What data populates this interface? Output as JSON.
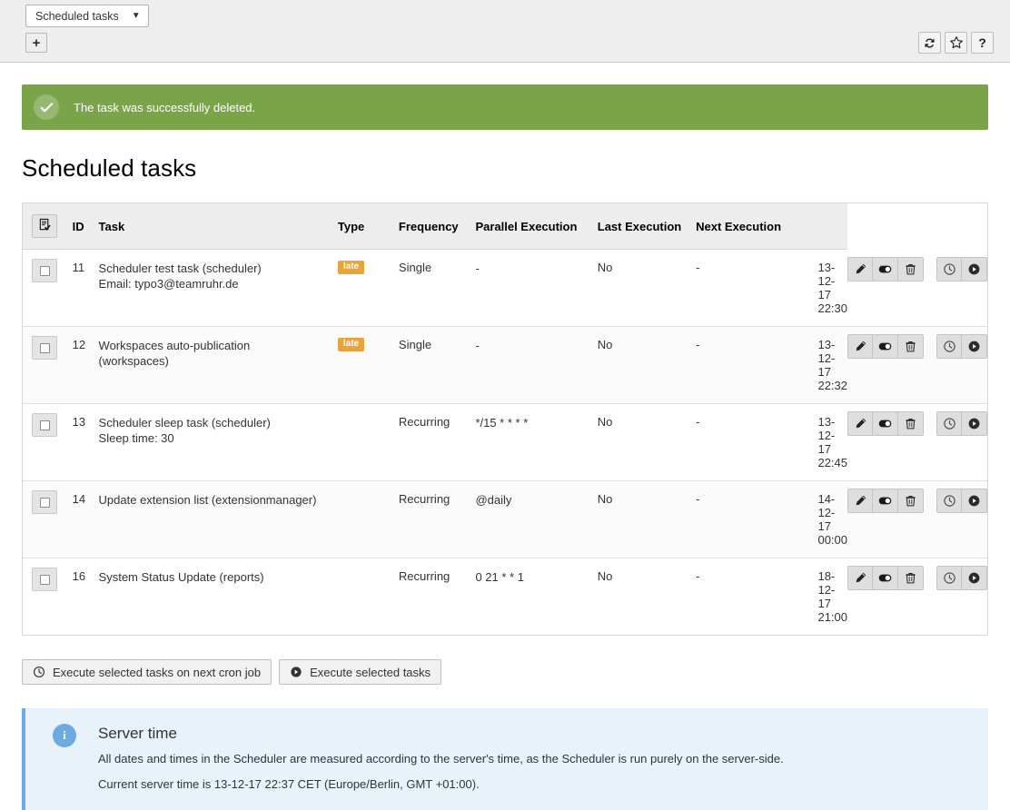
{
  "toolbar": {
    "module_select_value": "Scheduled tasks",
    "new_button_label": "+",
    "refresh_icon": "refresh-icon",
    "bookmark_icon": "star-icon",
    "help_label": "?"
  },
  "alert": {
    "icon": "checkmark-icon",
    "message": "The task was successfully deleted."
  },
  "page_title": "Scheduled tasks",
  "table": {
    "headers": {
      "check": "",
      "id": "ID",
      "task": "Task",
      "type": "Type",
      "frequency": "Frequency",
      "parallel": "Parallel Execution",
      "last": "Last Execution",
      "next": "Next Execution"
    },
    "rows": [
      {
        "id": "11",
        "task_title": "Scheduler test task (scheduler)",
        "task_sub": "Email: typo3@teamruhr.de",
        "badge": "late",
        "type": "Single",
        "frequency": "-",
        "parallel": "No",
        "last": "-",
        "next": "13-12-17 22:30"
      },
      {
        "id": "12",
        "task_title": "Workspaces auto-publication",
        "task_sub": "(workspaces)",
        "badge": "late",
        "type": "Single",
        "frequency": "-",
        "parallel": "No",
        "last": "-",
        "next": "13-12-17 22:32"
      },
      {
        "id": "13",
        "task_title": "Scheduler sleep task (scheduler)",
        "task_sub": "Sleep time: 30",
        "badge": "",
        "type": "Recurring",
        "frequency": "*/15 * * * *",
        "parallel": "No",
        "last": "-",
        "next": "13-12-17 22:45"
      },
      {
        "id": "14",
        "task_title": "Update extension list (extensionmanager)",
        "task_sub": "",
        "badge": "",
        "type": "Recurring",
        "frequency": "@daily",
        "parallel": "No",
        "last": "-",
        "next": "14-12-17 00:00"
      },
      {
        "id": "16",
        "task_title": "System Status Update (reports)",
        "task_sub": "",
        "badge": "",
        "type": "Recurring",
        "frequency": "0 21 * * 1",
        "parallel": "No",
        "last": "-",
        "next": "18-12-17 21:00"
      }
    ]
  },
  "bottom_actions": {
    "cron_label": "Execute selected tasks on next cron job",
    "execute_label": "Execute selected tasks"
  },
  "info": {
    "title": "Server time",
    "line1": "All dates and times in the Scheduler are measured according to the server's time, as the Scheduler is run purely on the server-side.",
    "line2": "Current server time is 13-12-17 22:37 CET (Europe/Berlin, GMT +01:00)."
  },
  "colors": {
    "success_green": "#79a548",
    "badge_orange": "#e8a33d",
    "info_blue": "#6daae0",
    "info_bg": "#e8f2fb",
    "toolbar_gray": "#eeeeee"
  }
}
